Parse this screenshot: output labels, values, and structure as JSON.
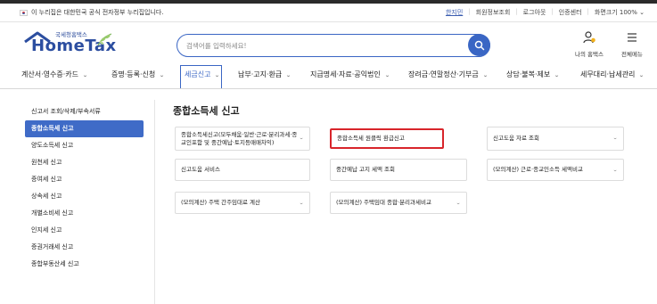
{
  "util": {
    "gov_notice": "이 누리집은 대한민국 공식 전자정부 누리집입니다.",
    "links": [
      "한지민",
      "회원정보조회",
      "로그아웃",
      "인증센터"
    ],
    "zoom_label": "화면크기 100%"
  },
  "logo": {
    "small": "국세청홈택스",
    "big": "HomeTax"
  },
  "search": {
    "placeholder": "검색어를 입력하세요!"
  },
  "header_icons": {
    "my": "나의 홈택스",
    "menu": "전체메뉴"
  },
  "gnb": [
    "계산서·영수증·카드",
    "증명·등록·신청",
    "세금신고",
    "납부·고지·환급",
    "지급명세·자료·공익법인",
    "장려금·연말정산·기부금",
    "상담·불복·제보",
    "세무대리·납세관리"
  ],
  "sidebar": [
    "신고서 조회/삭제/부속서류",
    "종합소득세 신고",
    "양도소득세 신고",
    "원천세 신고",
    "증여세 신고",
    "상속세 신고",
    "개별소비세 신고",
    "인지세 신고",
    "증권거래세 신고",
    "종합부동산세 신고"
  ],
  "content": {
    "title": "종합소득세 신고",
    "cards": [
      {
        "text": "종합소득세신고(모두채움·일반·근로·분리과세·종교인포함 및 중간예납·토지등매매차익)",
        "chevron": "⌄"
      },
      {
        "text": "종합소득세 원클릭 환급신고",
        "chevron": ""
      },
      {
        "text": "신고도움 자료 조회",
        "chevron": "⌄"
      },
      {
        "text": "신고도움 서비스",
        "chevron": ""
      },
      {
        "text": "중간예납 고지 세액 조회",
        "chevron": ""
      },
      {
        "text": "(모의계산) 근로·종교인소득 세액비교",
        "chevron": "⌄"
      },
      {
        "text": "(모의계산) 주택 간주임대료 계산",
        "chevron": "⌄"
      },
      {
        "text": "(모의계산) 주택임대 종합·분리과세비교",
        "chevron": "⌄"
      }
    ]
  }
}
